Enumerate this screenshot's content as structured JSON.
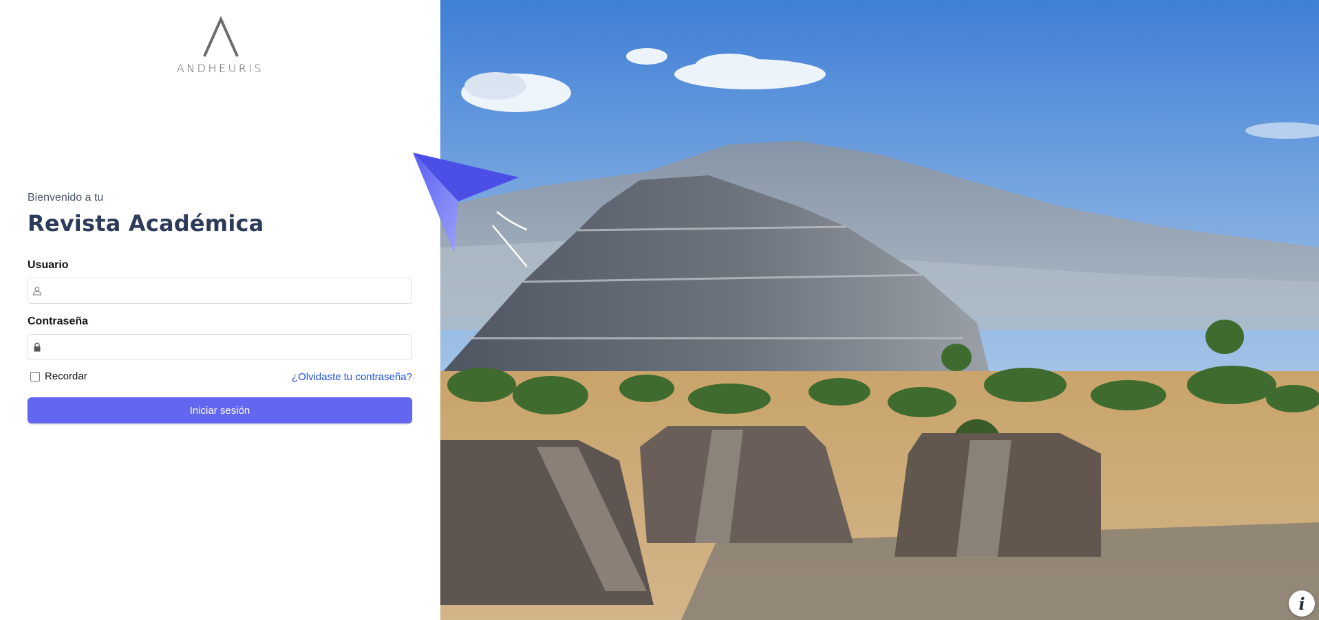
{
  "brand": {
    "logo_text": "ANDHEURIS",
    "logo_icon": "lambda-logo-icon"
  },
  "login": {
    "welcome_text": "Bienvenido a tu",
    "title": "Revista Académica",
    "username": {
      "label": "Usuario",
      "value": "",
      "placeholder": "",
      "icon": "user-icon"
    },
    "password": {
      "label": "Contraseña",
      "value": "",
      "placeholder": "",
      "icon": "lock-icon"
    },
    "remember_label": "Recordar",
    "remember_checked": false,
    "forgot_link": "¿Olvidaste tu contraseña?",
    "submit_label": "Iniciar sesión"
  },
  "hero": {
    "image_subject": "pyramid-landscape-photo",
    "decoration": "paper-plane-icon"
  },
  "info_button": {
    "glyph": "i",
    "icon": "info-icon"
  },
  "colors": {
    "primary": "#6366f1",
    "title": "#2d3b5a",
    "link": "#1d4ed8",
    "plane_light": "#8b8ff8",
    "plane_dark": "#5b5ef0"
  }
}
